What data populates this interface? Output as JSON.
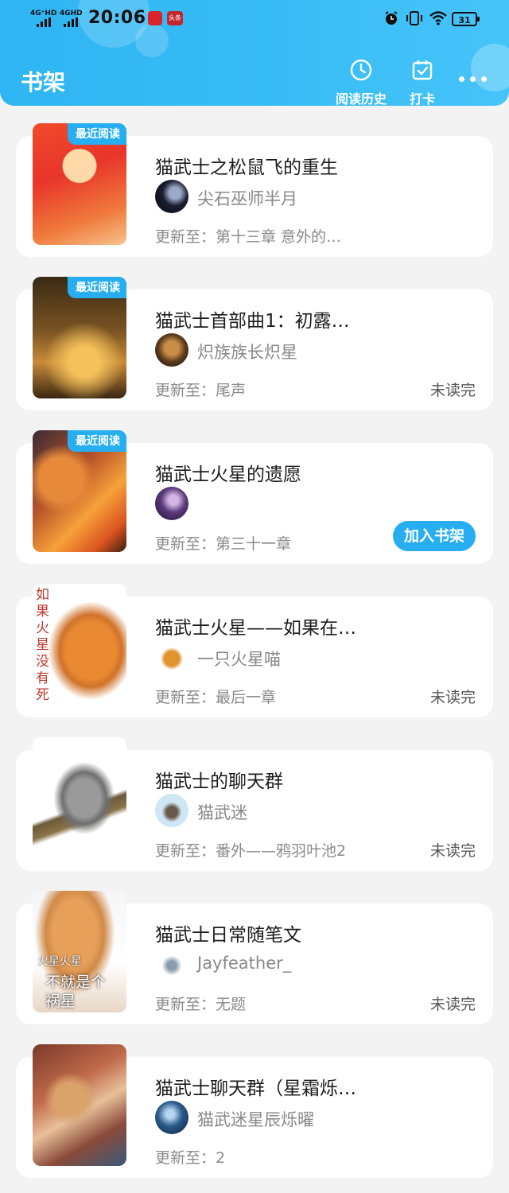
{
  "status_bar": {
    "network1": "4G⁺HD",
    "network2": "4GHD",
    "time": "20:06",
    "notif1": "头条",
    "battery": "31"
  },
  "header": {
    "title": "书架",
    "history_label": "阅读历史",
    "checkin_label": "打卡"
  },
  "books": [
    {
      "title": "猫武士之松鼠飞的重生",
      "author": "尖石巫师半月",
      "update": "更新至：第十三章 意外的…",
      "badge": "最近阅读",
      "status": ""
    },
    {
      "title": "猫武士首部曲1：初露…",
      "author": "炽族族长炽星",
      "update": "更新至：尾声",
      "badge": "最近阅读",
      "status": "未读完"
    },
    {
      "title": "猫武士火星的遗愿",
      "author": "",
      "update": "更新至：第三十一章",
      "badge": "最近阅读",
      "action": "加入书架"
    },
    {
      "title": "猫武士火星——如果在…",
      "author": "一只火星喵",
      "update": "更新至：最后一章",
      "badge": "",
      "status": "未读完",
      "cover_text": "如果火星没有死"
    },
    {
      "title": "猫武士的聊天群",
      "author": "猫武迷",
      "update": "更新至：番外——鸦羽叶池2",
      "badge": "",
      "status": "未读完"
    },
    {
      "title": "猫武士日常随笔文",
      "author": "Jayfeather_",
      "update": "更新至：无题",
      "badge": "",
      "status": "未读完",
      "cover_text1": "火星火星",
      "cover_text2": "不就是个",
      "cover_text3": "祸星"
    },
    {
      "title": "猫武士聊天群（星霜烁…",
      "author": "猫武迷星辰烁曜",
      "update": "更新至：2",
      "badge": "",
      "status": ""
    }
  ],
  "colors": {
    "accent": "#26aef1",
    "header": "#39bcf6",
    "background": "#f3f3f3"
  }
}
